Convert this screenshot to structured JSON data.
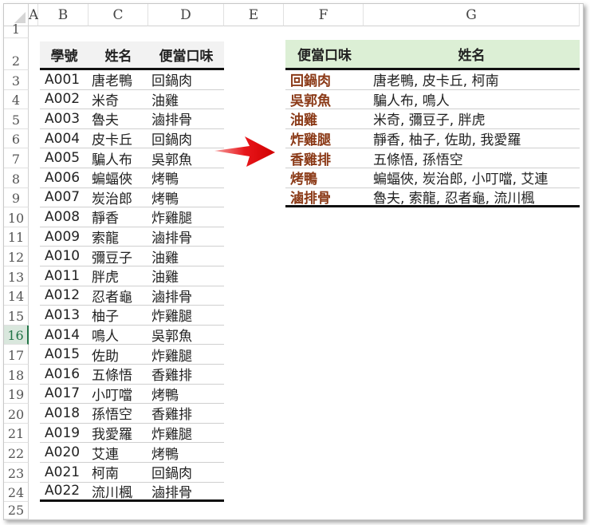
{
  "columns": [
    "A",
    "B",
    "C",
    "D",
    "E",
    "F",
    "G"
  ],
  "row_numbers": [
    "1",
    "2",
    "3",
    "4",
    "5",
    "6",
    "7",
    "8",
    "9",
    "10",
    "11",
    "12",
    "13",
    "14",
    "15",
    "16",
    "17",
    "18",
    "19",
    "20",
    "21",
    "22",
    "23",
    "24",
    "25"
  ],
  "selected_row": "16",
  "left_table": {
    "headers": [
      "學號",
      "姓名",
      "便當口味"
    ],
    "rows": [
      [
        "A001",
        "唐老鴨",
        "回鍋肉"
      ],
      [
        "A002",
        "米奇",
        "油雞"
      ],
      [
        "A003",
        "魯夫",
        "滷排骨"
      ],
      [
        "A004",
        "皮卡丘",
        "回鍋肉"
      ],
      [
        "A005",
        "騙人布",
        "吳郭魚"
      ],
      [
        "A006",
        "蝙蝠俠",
        "烤鴨"
      ],
      [
        "A007",
        "炭治郎",
        "烤鴨"
      ],
      [
        "A008",
        "靜香",
        "炸雞腿"
      ],
      [
        "A009",
        "索龍",
        "滷排骨"
      ],
      [
        "A010",
        "彌豆子",
        "油雞"
      ],
      [
        "A011",
        "胖虎",
        "油雞"
      ],
      [
        "A012",
        "忍者龜",
        "滷排骨"
      ],
      [
        "A013",
        "柚子",
        "炸雞腿"
      ],
      [
        "A014",
        "鳴人",
        "吳郭魚"
      ],
      [
        "A015",
        "佐助",
        "炸雞腿"
      ],
      [
        "A016",
        "五條悟",
        "香雞排"
      ],
      [
        "A017",
        "小叮噹",
        "烤鴨"
      ],
      [
        "A018",
        "孫悟空",
        "香雞排"
      ],
      [
        "A019",
        "我愛羅",
        "炸雞腿"
      ],
      [
        "A020",
        "艾連",
        "烤鴨"
      ],
      [
        "A021",
        "柯南",
        "回鍋肉"
      ],
      [
        "A022",
        "流川楓",
        "滷排骨"
      ]
    ]
  },
  "right_table": {
    "headers": [
      "便當口味",
      "姓名"
    ],
    "rows": [
      [
        "回鍋肉",
        "唐老鴨, 皮卡丘, 柯南"
      ],
      [
        "吳郭魚",
        "騙人布, 鳴人"
      ],
      [
        "油雞",
        "米奇, 彌豆子, 胖虎"
      ],
      [
        "炸雞腿",
        "靜香, 柚子, 佐助, 我愛羅"
      ],
      [
        "香雞排",
        "五條悟, 孫悟空"
      ],
      [
        "烤鴨",
        "蝙蝠俠, 炭治郎, 小叮噹, 艾連"
      ],
      [
        "滷排骨",
        "魯夫, 索龍, 忍者龜, 流川楓"
      ]
    ]
  },
  "colors": {
    "arrow": "#e8161b",
    "right_header_bg": "#dcefd5",
    "left_header_bg": "#f2f2f2",
    "flavor_text": "#8b3a17"
  }
}
